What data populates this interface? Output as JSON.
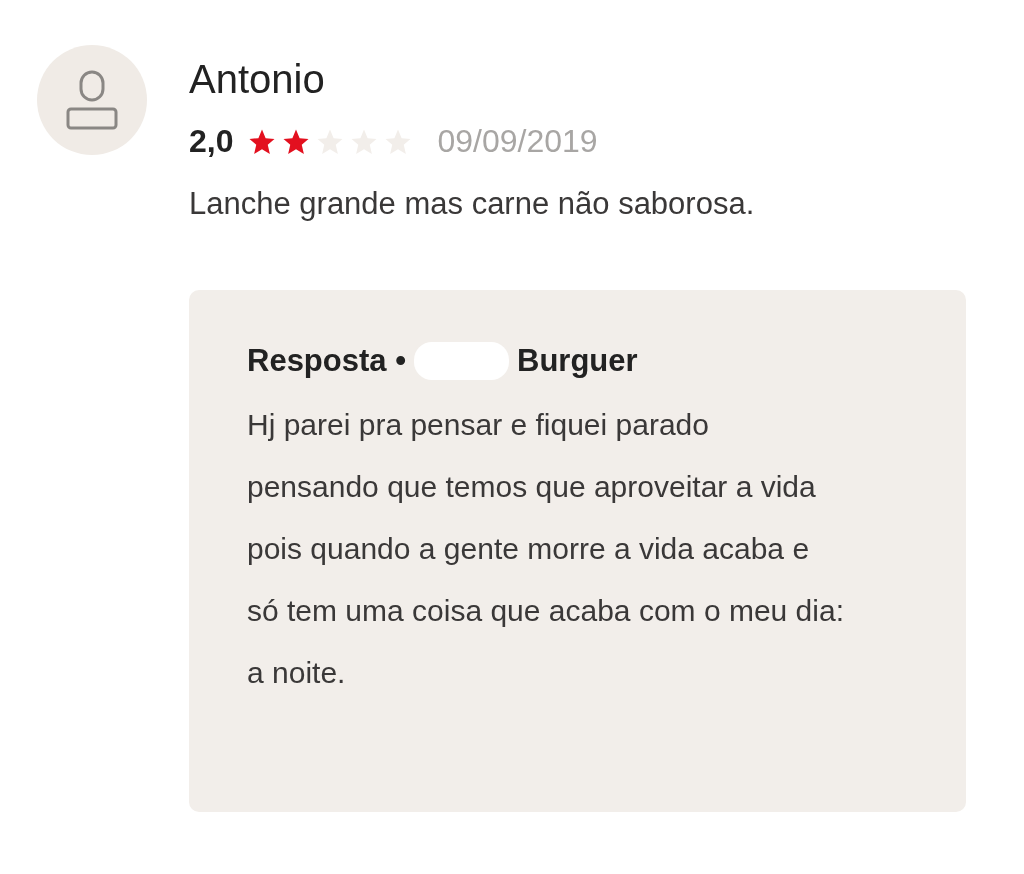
{
  "review": {
    "author": "Antonio",
    "rating": "2,0",
    "stars": 2,
    "date": "09/09/2019",
    "comment": "Lanche grande mas carne não saborosa.",
    "reply": {
      "label": "Resposta •",
      "redacted": true,
      "name": "Burguer",
      "text": "Hj parei pra pensar e fiquei parado pensando que temos que aproveitar a vida pois quando a gente morre a vida acaba e só tem uma coisa que acaba com o meu dia: a noite."
    }
  }
}
